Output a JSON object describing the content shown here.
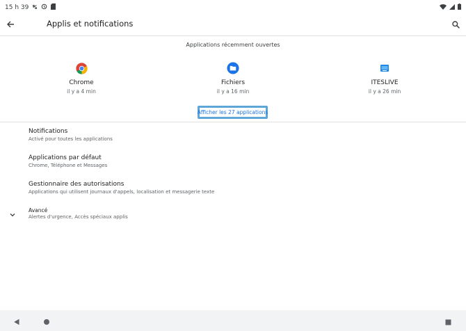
{
  "status_bar": {
    "time": "15 h 39",
    "left_icons": [
      "usb-debug-icon",
      "sync-icon",
      "sim-card-icon"
    ],
    "right_icons": [
      "wifi-icon",
      "signal-icon",
      "battery-icon"
    ]
  },
  "app_bar": {
    "title": "Applis et notifications",
    "back_icon": "arrow-back-icon",
    "search_icon": "search-icon"
  },
  "recent": {
    "header": "Applications récemment ouvertes",
    "apps": [
      {
        "name": "Chrome",
        "time": "il y a 4 min",
        "icon": "chrome-icon"
      },
      {
        "name": "Fichiers",
        "time": "il y a 16 min",
        "icon": "files-folder-icon"
      },
      {
        "name": "ITESLIVE",
        "time": "il y a 26 min",
        "icon": "iteslive-icon"
      }
    ],
    "show_all_label": "Afficher les 27 applications"
  },
  "settings": [
    {
      "title": "Notifications",
      "summary": "Activé pour toutes les applications"
    },
    {
      "title": "Applications par défaut",
      "summary": "Chrome, Téléphone et Messages"
    },
    {
      "title": "Gestionnaire des autorisations",
      "summary": "Applications qui utilisent journaux d'appels, localisation et messagerie texte"
    },
    {
      "title": "Avancé",
      "summary": "Alertes d'urgence, Accès spéciaux applis",
      "icon": "chevron-down-icon"
    }
  ],
  "colors": {
    "accent": "#1a73e8",
    "highlight_border": "#5ea5d8",
    "nav_bar": "#f1f3f4"
  }
}
